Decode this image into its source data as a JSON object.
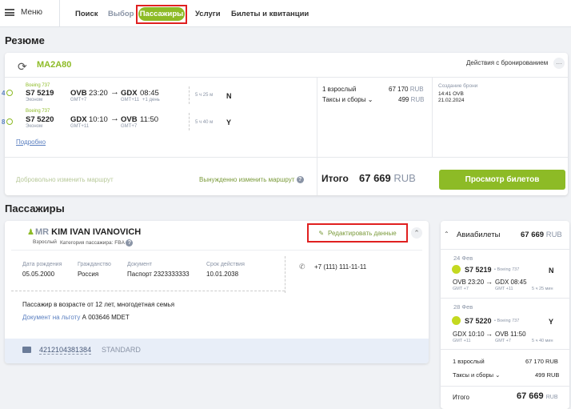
{
  "topbar": {
    "menu_label": "Меню",
    "tabs": [
      {
        "label": "Поиск"
      },
      {
        "label": "Выбор"
      },
      {
        "label": "Пассажиры"
      },
      {
        "label": "Услуги"
      },
      {
        "label": "Билеты и квитанции"
      }
    ]
  },
  "resume": {
    "title": "Резюме",
    "pnr": "MA2A80",
    "actions_label": "Действия с бронированием",
    "segments": [
      {
        "num": "4",
        "aircraft": "Boeing 737",
        "flight": "S7  5219",
        "class": "Эконом",
        "from": "OVB",
        "dep_time": "23:20",
        "from_gmt": "GMT+7",
        "to": "GDX",
        "arr_time": "08:45",
        "to_gmt": "GMT+11",
        "next_day": "+1 день",
        "duration": "5 ч 25 м",
        "booking_class": "N"
      },
      {
        "num": "8",
        "aircraft": "Boeing 737",
        "flight": "S7  5220",
        "class": "Эконом",
        "from": "GDX",
        "dep_time": "10:10",
        "from_gmt": "GMT+11",
        "to": "OVB",
        "arr_time": "11:50",
        "to_gmt": "GMT+7",
        "next_day": "",
        "duration": "5 ч 40 м",
        "booking_class": "Y"
      }
    ],
    "details_link": "Подробно",
    "adult_label": "1 взрослый",
    "adult_price": "67 170",
    "taxes_label": "Таксы и сборы",
    "taxes_price": "499",
    "currency": "RUB",
    "created_label": "Создание брони",
    "created_time": "14:41 OVB",
    "created_date": "21.02.2024",
    "voluntary_change": "Добровольно изменить маршрут",
    "forced_change": "Вынужденно изменить маршрут",
    "total_label": "Итого",
    "total_value": "67 669",
    "view_tickets_button": "Просмотр билетов"
  },
  "passengers": {
    "title": "Пассажиры",
    "title_prefix": "MR",
    "name": "KIM IVAN IVANOVICH",
    "type": "Взрослый",
    "category": "Категория пассажира: FBA",
    "edit_button": "Редактировать данные",
    "fields": [
      {
        "label": "Дата рождения",
        "value": "05.05.2000"
      },
      {
        "label": "Гражданство",
        "value": "Россия"
      },
      {
        "label": "Документ",
        "value": "Паспорт 2323333333"
      },
      {
        "label": "Срок действия",
        "value": "10.01.2038"
      }
    ],
    "phone": "+7 (111) 111-11-11",
    "note": "Пассажир в возрасте от 12 лет, многодетная семья",
    "benefit_doc": "Документ на льготу",
    "benefit_doc_value": "А 003646 MDET",
    "ticket_number": "4212104381384",
    "ticket_status": "STANDARD"
  },
  "sidebar": {
    "title": "Авиабилеты",
    "total": "67 669",
    "currency": "RUB",
    "segments": [
      {
        "date": "24 Фев",
        "flight": "S7 5219",
        "aircraft": "• Boeing 737",
        "class": "N",
        "from": "OVB 23:20",
        "to": "GDX 08:45",
        "from_gmt": "GMT +7",
        "to_gmt": "GMT +11",
        "duration": "5 ч 25 мин"
      },
      {
        "date": "28 Фев",
        "flight": "S7 5220",
        "aircraft": "• Boeing 737",
        "class": "Y",
        "from": "GDX 10:10",
        "to": "OVB 11:50",
        "from_gmt": "GMT +11",
        "to_gmt": "GMT +7",
        "duration": "5 ч 40 мин"
      }
    ],
    "adult_label": "1 взрослый",
    "adult_price": "67 170 RUB",
    "taxes_label": "Таксы и сборы",
    "taxes_price": "499 RUB",
    "total_label": "Итого",
    "total_value": "67 669"
  }
}
